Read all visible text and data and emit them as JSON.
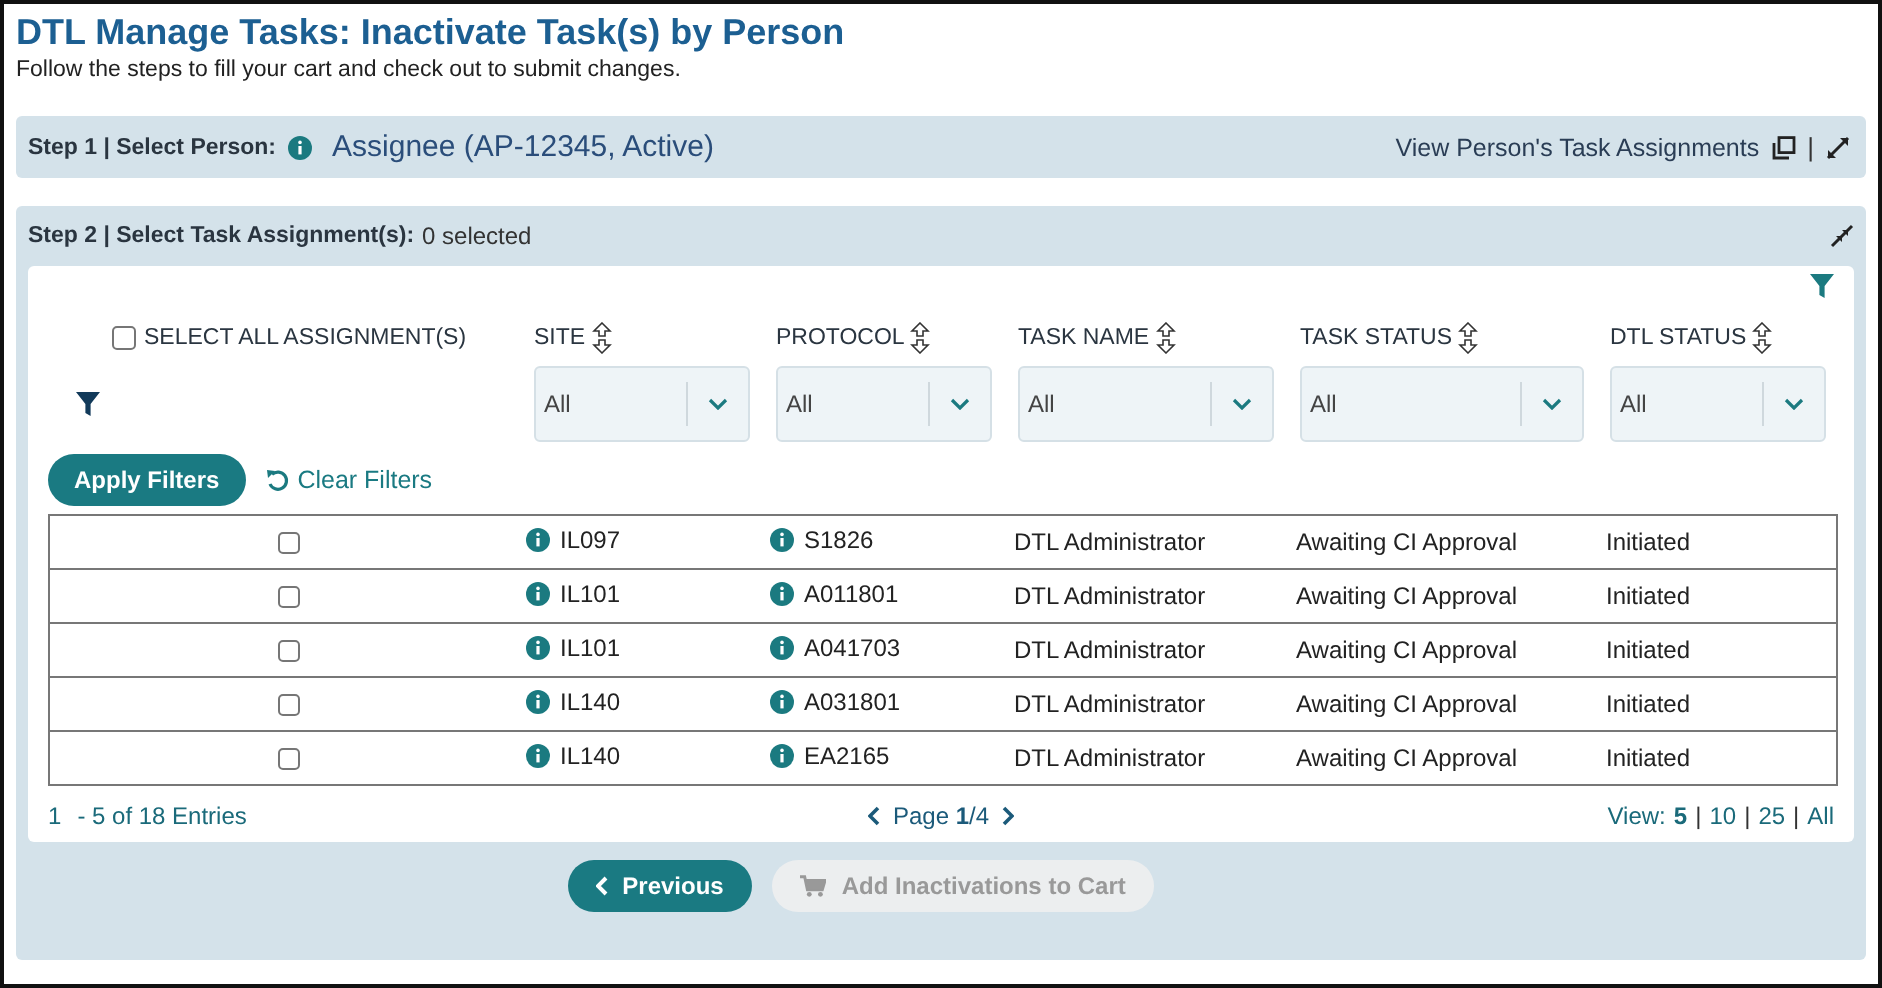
{
  "title": "DTL Manage Tasks: Inactivate Task(s) by Person",
  "subtitle": "Follow the steps to fill your cart and check out to submit changes.",
  "step1": {
    "label": "Step 1 | Select Person:",
    "person": "Assignee (AP-12345, Active)",
    "link": "View Person's Task Assignments",
    "separator": "|"
  },
  "step2": {
    "label": "Step 2 | Select Task Assignment(s):",
    "count": "0 selected"
  },
  "select_all": {
    "label": "SELECT ALL ASSIGNMENT(S)",
    "checked": false
  },
  "columns": [
    {
      "label": "SITE",
      "filter": "All"
    },
    {
      "label": "PROTOCOL",
      "filter": "All"
    },
    {
      "label": "TASK NAME",
      "filter": "All"
    },
    {
      "label": "TASK STATUS",
      "filter": "All"
    },
    {
      "label": "DTL STATUS",
      "filter": "All"
    }
  ],
  "apply_filters": "Apply Filters",
  "clear_filters": "Clear Filters",
  "rows": [
    {
      "checked": false,
      "site": "IL097",
      "protocol": "S1826",
      "task_name": "DTL Administrator",
      "task_status": "Awaiting CI Approval",
      "dtl_status": "Initiated"
    },
    {
      "checked": false,
      "site": "IL101",
      "protocol": "A011801",
      "task_name": "DTL Administrator",
      "task_status": "Awaiting CI Approval",
      "dtl_status": "Initiated"
    },
    {
      "checked": false,
      "site": "IL101",
      "protocol": "A041703",
      "task_name": "DTL Administrator",
      "task_status": "Awaiting CI Approval",
      "dtl_status": "Initiated"
    },
    {
      "checked": false,
      "site": "IL140",
      "protocol": "A031801",
      "task_name": "DTL Administrator",
      "task_status": "Awaiting CI Approval",
      "dtl_status": "Initiated"
    },
    {
      "checked": false,
      "site": "IL140",
      "protocol": "EA2165",
      "task_name": "DTL Administrator",
      "task_status": "Awaiting CI Approval",
      "dtl_status": "Initiated"
    }
  ],
  "pagination": {
    "range_start": "1",
    "range_rest": "- 5 of 18 Entries",
    "page": "Page **1**/4",
    "view_label": "View:",
    "separator": "|",
    "page_sizes": [
      {
        "label": "5",
        "selected": true
      },
      {
        "label": "10",
        "selected": false
      },
      {
        "label": "25",
        "selected": false
      },
      {
        "label": "All",
        "selected": false
      }
    ]
  },
  "previous": "Previous",
  "add_to_cart": {
    "label": "Add Inactivations to Cart",
    "disabled": true
  }
}
